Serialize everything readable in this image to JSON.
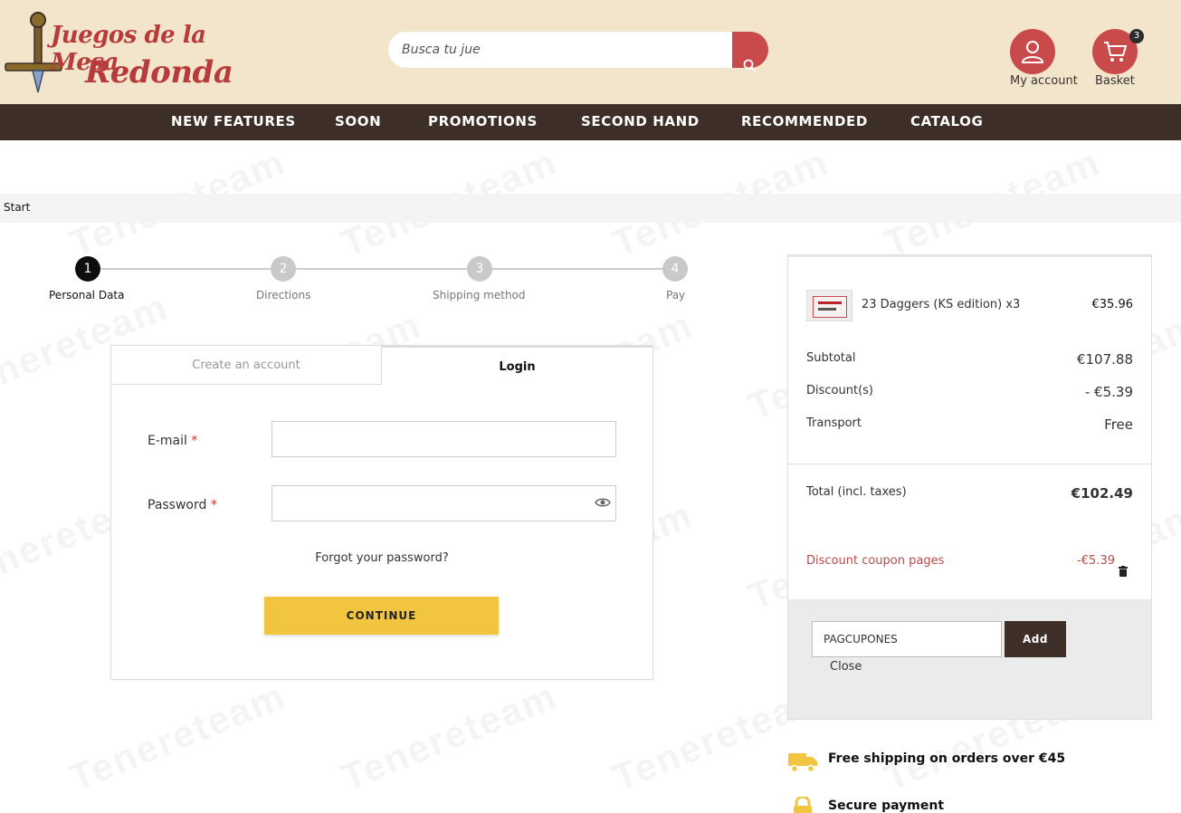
{
  "header": {
    "logo_line1": "Juegos de la Mesa",
    "logo_line2": "Redonda",
    "search_placeholder": "Busca tu jue",
    "account_label": "My account",
    "basket_label": "Basket",
    "basket_count": "3"
  },
  "nav": {
    "items": [
      "NEW FEATURES",
      "SOON",
      "PROMOTIONS",
      "SECOND HAND",
      "RECOMMENDED",
      "CATALOG"
    ]
  },
  "breadcrumb": {
    "start": "Start"
  },
  "steps": [
    {
      "number": "1",
      "label": "Personal Data"
    },
    {
      "number": "2",
      "label": "Directions"
    },
    {
      "number": "3",
      "label": "Shipping method"
    },
    {
      "number": "4",
      "label": "Pay"
    }
  ],
  "login": {
    "tab_create": "Create an account",
    "tab_login": "Login",
    "email_label": "E-mail",
    "password_label": "Password",
    "required_mark": "*",
    "forgot": "Forgot your password?",
    "continue": "CONTINUE"
  },
  "summary": {
    "product_name": "23 Daggers (KS edition) x3",
    "product_price": "€35.96",
    "subtotal_label": "Subtotal",
    "subtotal_value": "€107.88",
    "discount_label": "Discount(s)",
    "discount_value": "- €5.39",
    "transport_label": "Transport",
    "transport_value": "Free",
    "total_label": "Total (incl. taxes)",
    "total_value": "€102.49",
    "coupon_label": "Discount coupon pages",
    "coupon_value": "-€5.39",
    "coupon_code": "PAGCUPONES",
    "add_label": "Add",
    "close_label": "Close"
  },
  "reassurance": {
    "shipping": "Free shipping on orders over €45",
    "payment": "Secure payment"
  },
  "colors": {
    "brand_red": "#c94a4a",
    "header_bg": "#f3e5cb",
    "nav_bg": "#3d2e28",
    "continue_yellow": "#f2c540"
  }
}
